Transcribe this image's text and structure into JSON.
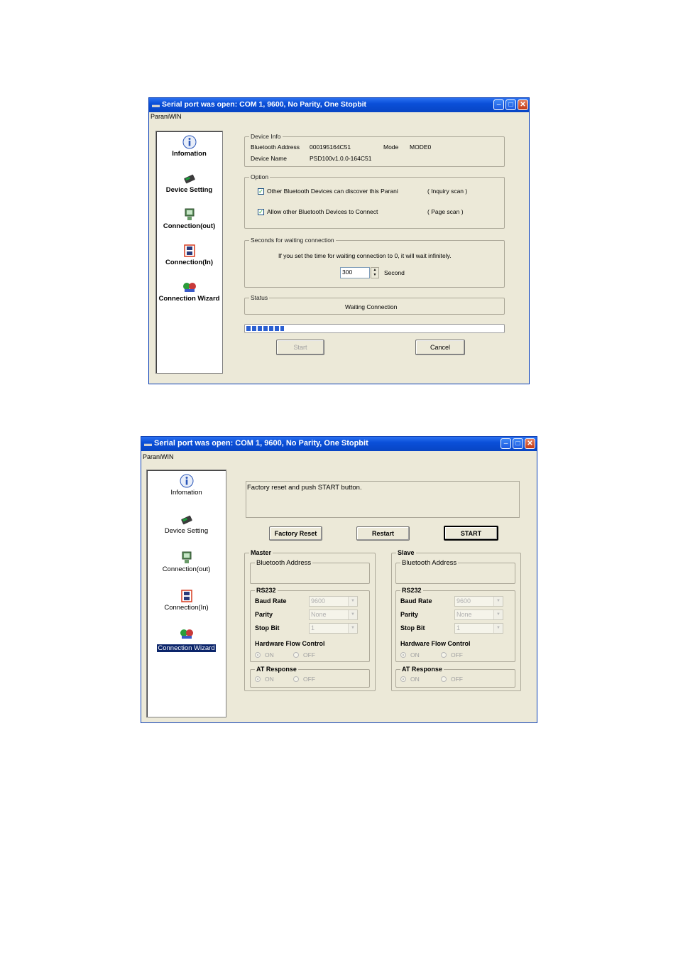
{
  "window1": {
    "title": "Serial port was open: COM 1, 9600, No Parity, One Stopbit",
    "menu": "ParaniWIN",
    "nav": [
      {
        "label": "Infomation",
        "icon": "info-icon"
      },
      {
        "label": "Device Setting",
        "icon": "device-icon"
      },
      {
        "label": "Connection(out)",
        "icon": "connection-out-icon"
      },
      {
        "label": "Connection(In)",
        "icon": "connection-in-icon"
      },
      {
        "label": "Connection Wizard",
        "icon": "wizard-icon"
      }
    ],
    "device_info": {
      "legend": "Device Info",
      "bt_address_label": "Bluetooth Address",
      "bt_address": "000195164C51",
      "mode_label": "Mode",
      "mode": "MODE0",
      "device_name_label": "Device Name",
      "device_name": "PSD100v1.0.0-164C51"
    },
    "option": {
      "legend": "Option",
      "discover_label": "Other Bluetooth Devices can discover this Parani",
      "discover_hint": "( Inquiry scan )",
      "discover_checked": true,
      "connect_label": "Allow other Bluetooth Devices to Connect",
      "connect_hint": "( Page scan )",
      "connect_checked": true
    },
    "waiting": {
      "legend": "Seconds for waiting connection",
      "hint": "If you set the time for waiting connection to 0, it will wait infinitely.",
      "value": "300",
      "unit": "Second"
    },
    "status": {
      "legend": "Status",
      "text": "Waiting Connection"
    },
    "progress_fraction": 0.15,
    "start_label": "Start",
    "cancel_label": "Cancel"
  },
  "window2": {
    "title": "Serial port was open: COM 1, 9600, No Parity, One Stopbit",
    "menu": "ParaniWIN",
    "nav": [
      {
        "label": "Infomation",
        "icon": "info-icon"
      },
      {
        "label": "Device Setting",
        "icon": "device-icon"
      },
      {
        "label": "Connection(out)",
        "icon": "connection-out-icon"
      },
      {
        "label": "Connection(In)",
        "icon": "connection-in-icon"
      },
      {
        "label": "Connection Wizard",
        "icon": "wizard-icon",
        "selected": true
      }
    ],
    "message": "Factory reset and push START button.",
    "factory_reset_label": "Factory Reset",
    "restart_label": "Restart",
    "start_label": "START",
    "master": {
      "legend": "Master",
      "bt_address_legend": "Bluetooth Address",
      "rs232_legend": "RS232",
      "baud_label": "Baud Rate",
      "baud_value": "9600",
      "parity_label": "Parity",
      "parity_value": "None",
      "stop_label": "Stop Bit",
      "stop_value": "1",
      "hw_flow_label": "Hardware Flow Control",
      "on_label": "ON",
      "off_label": "OFF",
      "at_legend": "AT Response"
    },
    "slave": {
      "legend": "Slave",
      "bt_address_legend": "Bluetooth Address",
      "rs232_legend": "RS232",
      "baud_label": "Baud Rate",
      "baud_value": "9600",
      "parity_label": "Parity",
      "parity_value": "None",
      "stop_label": "Stop Bit",
      "stop_value": "1",
      "hw_flow_label": "Hardware Flow Control",
      "on_label": "ON",
      "off_label": "OFF",
      "at_legend": "AT Response"
    }
  }
}
